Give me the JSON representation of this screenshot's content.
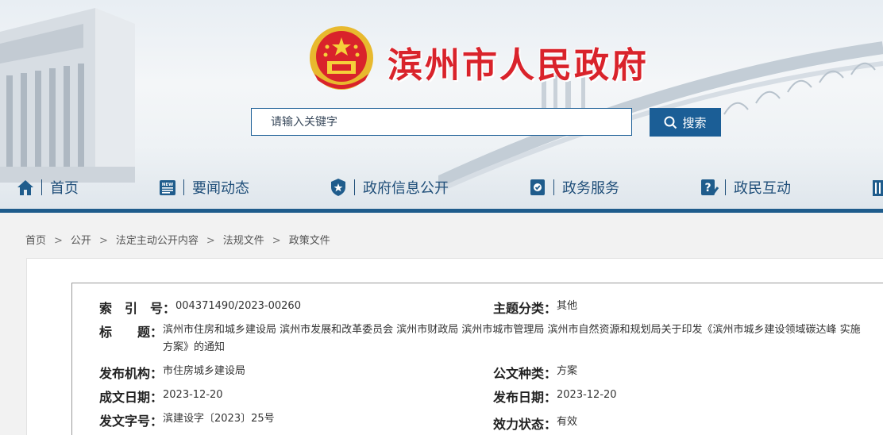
{
  "header": {
    "site_title": "滨州市人民政府",
    "search": {
      "placeholder": "请输入关键字",
      "button_label": "搜索"
    }
  },
  "nav": {
    "items": [
      {
        "label": "首页",
        "icon": "home-icon"
      },
      {
        "label": "要闻动态",
        "icon": "news-icon"
      },
      {
        "label": "政府信息公开",
        "icon": "badge-icon"
      },
      {
        "label": "政务服务",
        "icon": "service-icon"
      },
      {
        "label": "政民互动",
        "icon": "question-icon"
      }
    ],
    "accent": "#1f5c8c"
  },
  "breadcrumb": [
    "首页",
    "公开",
    "法定主动公开内容",
    "法规文件",
    "政策文件"
  ],
  "document": {
    "index_no": {
      "label": "索　引　号：",
      "value": "004371490/2023-00260"
    },
    "category": {
      "label": "主题分类：",
      "value": "其他"
    },
    "title": {
      "label": "标　　题：",
      "value": "滨州市住房和城乡建设局 滨州市发展和改革委员会 滨州市财政局 滨州市城市管理局 滨州市自然资源和规划局关于印发《滨州市城乡建设领域碳达峰 实施方案》的通知"
    },
    "publisher": {
      "label": "发布机构：",
      "value": "市住房城乡建设局"
    },
    "doc_type": {
      "label": "公文种类：",
      "value": "方案"
    },
    "created": {
      "label": "成文日期：",
      "value": "2023-12-20"
    },
    "published": {
      "label": "发布日期：",
      "value": "2023-12-20"
    },
    "doc_no": {
      "label": "发文字号：",
      "value": "滨建设字〔2023〕25号"
    },
    "status": {
      "label": "效力状态：",
      "value": "有效"
    }
  },
  "colors": {
    "title_red": "#d9232b",
    "primary_blue": "#1b5e96"
  }
}
